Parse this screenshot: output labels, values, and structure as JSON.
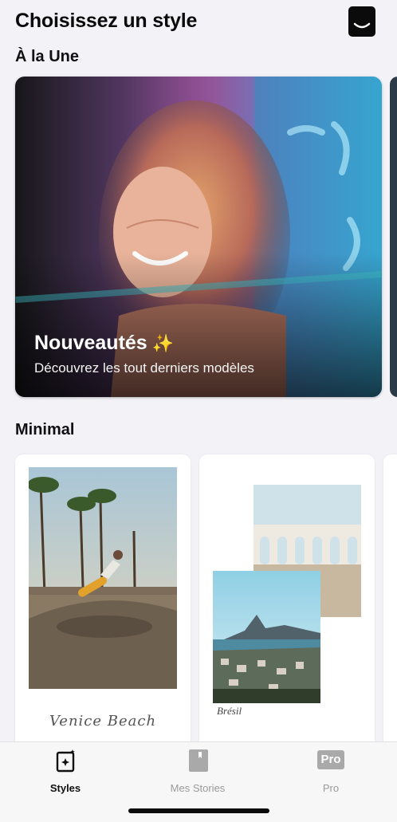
{
  "header": {
    "title": "Choisissez un style",
    "logo_icon": "app-logo-icon"
  },
  "featured_section": {
    "title": "À la Une",
    "card": {
      "title": "Nouveautés",
      "sparkle": "✨",
      "subtitle": "Découvrez les tout derniers modèles"
    }
  },
  "minimal_section": {
    "title": "Minimal",
    "templates": [
      {
        "caption": "Venice Beach"
      },
      {
        "caption": "Brésil"
      }
    ]
  },
  "tabbar": {
    "tabs": [
      {
        "label": "Styles",
        "icon": "styles-sparkle-icon",
        "active": true
      },
      {
        "label": "Mes Stories",
        "icon": "bookmark-icon",
        "active": false
      },
      {
        "label": "Pro",
        "icon": "pro-badge-icon",
        "badge": "Pro",
        "active": false
      }
    ]
  },
  "colors": {
    "background": "#f2f2f7",
    "active_tab": "#111111",
    "inactive_tab": "#9a9a9a"
  }
}
